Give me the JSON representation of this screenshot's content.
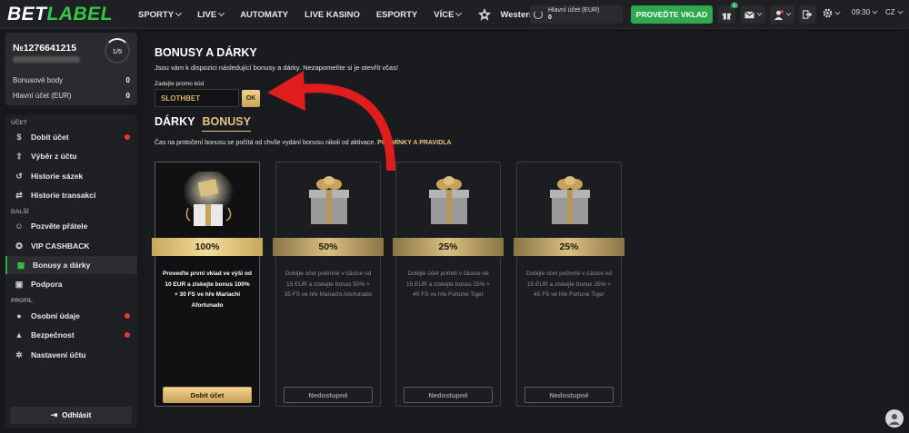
{
  "logo": {
    "bet": "BET",
    "label": "LABEL"
  },
  "nav": {
    "items": [
      {
        "label": "SPORTY",
        "dropdown": true
      },
      {
        "label": "LIVE",
        "dropdown": true
      },
      {
        "label": "AUTOMATY",
        "dropdown": false
      },
      {
        "label": "LIVE KASINO",
        "dropdown": false
      },
      {
        "label": "ESPORTY",
        "dropdown": false
      },
      {
        "label": "VÍCE",
        "dropdown": true
      }
    ],
    "western_slot": "Western slot"
  },
  "header": {
    "balance_label": "Hlavní účet (EUR)",
    "balance_value": "0",
    "deposit_button": "PROVEĎTE VKLAD",
    "gift_badge": "1",
    "time": "09:30",
    "language": "CZ"
  },
  "account": {
    "id": "№1276641215",
    "level": "1/5",
    "bonus_points_label": "Bonusové body",
    "bonus_points_value": "0",
    "main_account_label": "Hlavní účet (EUR)",
    "main_account_value": "0"
  },
  "sidebar": {
    "section_account": "ÚČET",
    "section_more": "DALŠÍ",
    "section_profile": "PROFIL",
    "items": [
      {
        "label": "Dobít účet",
        "icon": "dollar-icon",
        "alert": true
      },
      {
        "label": "Výběr z účtu",
        "icon": "upload-icon",
        "alert": false
      },
      {
        "label": "Historie sázek",
        "icon": "history-icon",
        "alert": false
      },
      {
        "label": "Historie transakcí",
        "icon": "transfer-icon",
        "alert": false
      },
      {
        "label": "Pozvěte přátele",
        "icon": "user-plus-icon",
        "alert": false
      },
      {
        "label": "VIP CASHBACK",
        "icon": "vip-icon",
        "alert": false
      },
      {
        "label": "Bonusy a dárky",
        "icon": "gift-icon",
        "alert": false
      },
      {
        "label": "Podpora",
        "icon": "support-icon",
        "alert": false
      },
      {
        "label": "Osobní údaje",
        "icon": "person-icon",
        "alert": true
      },
      {
        "label": "Bezpečnost",
        "icon": "lock-icon",
        "alert": true
      },
      {
        "label": "Nastavení účtu",
        "icon": "gear-icon",
        "alert": false
      }
    ],
    "logout": "Odhlásit"
  },
  "main": {
    "title": "BONUSY A DÁRKY",
    "subtitle": "Jsou vám k dispozici následující bonusy a dárky. Nezapomeňte si je otevřít včas!",
    "promo_label": "Zadejte promo kód",
    "promo_value": "SLOTHBET",
    "ok_button": "OK",
    "tab_gifts": "DÁRKY",
    "tab_bonuses": "BONUSY",
    "timing_note": "Čas na protočení bonusu se počítá od chvíle vydání bonusu nikoli od aktivace.",
    "rules_link": "PODMÍNKY A PRAVIDLA"
  },
  "cards": [
    {
      "percent": "100%",
      "description": "Proveďte první vklad ve výši od 10 EUR a získejte bonus 100% + 30 FS ve hře Mariachi Afortunado",
      "button": "Dobít účet"
    },
    {
      "percent": "50%",
      "description": "Dobijte účet podruhé v částce od 15 EUR a získejte bonus 50% + 35 FS ve hře Mariachi Afortunado",
      "button": "Nedostupné"
    },
    {
      "percent": "25%",
      "description": "Dobijte účet potřetí v částce od 15 EUR a získejte bonus 25% + 40 FS ve hře Fortune Tiger",
      "button": "Nedostupné"
    },
    {
      "percent": "25%",
      "description": "Dobijte účet počtvrté v částce od 15 EUR a získejte bonus 25% + 45 FS ve hře Fortune Tiger",
      "button": "Nedostupné"
    }
  ],
  "colors": {
    "brand_green": "#35c745",
    "gold": "#e6c57e",
    "alert_red": "#e8393a",
    "annotation_arrow": "#e01d1d"
  }
}
